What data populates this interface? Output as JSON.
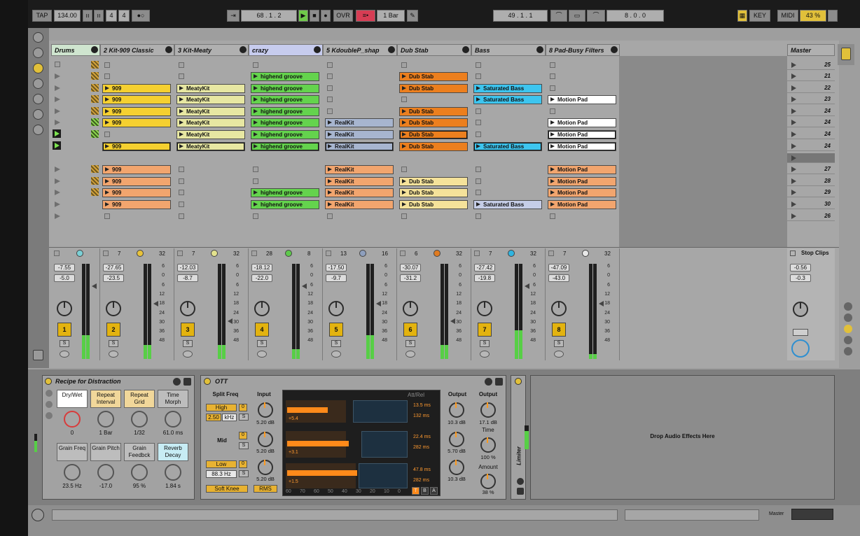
{
  "transport": {
    "tap": "TAP",
    "tempo": "134.00",
    "sig_num": "4",
    "sig_den": "4",
    "position": "68 . 1 . 2",
    "ovr": "OVR",
    "quantize": "1 Bar",
    "loop_start": "49 . 1 . 1",
    "loop_len": "8 . 0 . 0",
    "key": "KEY",
    "midi": "MIDI",
    "cpu": "43 %"
  },
  "tracks": [
    {
      "name": "Drums",
      "num": "1",
      "vol": "-7.55",
      "peak": "-5.0",
      "s1": "",
      "s2": "",
      "color": "#7bd0d6"
    },
    {
      "name": "2 Kit-909 Classic",
      "num": "2",
      "vol": "-27.65",
      "peak": "-23.5",
      "s1": "7",
      "s2": "32",
      "color": "#e8c23a"
    },
    {
      "name": "3 Kit-Meaty",
      "num": "3",
      "vol": "-12.03",
      "peak": "-8.7",
      "s1": "7",
      "s2": "32",
      "color": "#e3e28e"
    },
    {
      "name": "crazy",
      "num": "4",
      "vol": "-18.12",
      "peak": "-22.0",
      "s1": "28",
      "s2": "8",
      "color": "#5ec94b"
    },
    {
      "name": "5 KdoubleP_shap",
      "num": "5",
      "vol": "-17.50",
      "peak": "-9.7",
      "s1": "13",
      "s2": "16",
      "color": "#8e9fbd"
    },
    {
      "name": "Dub Stab",
      "num": "6",
      "vol": "-30.07",
      "peak": "-31.2",
      "s1": "6",
      "s2": "32",
      "color": "#e07b20"
    },
    {
      "name": "Bass",
      "num": "7",
      "vol": "-27.42",
      "peak": "-19.8",
      "s1": "7",
      "s2": "32",
      "color": "#2fb4e0"
    },
    {
      "name": "8 Pad-Busy Filters",
      "num": "8",
      "vol": "-47.09",
      "peak": "-43.0",
      "s1": "7",
      "s2": "32",
      "color": "#e8e8e8"
    }
  ],
  "master": {
    "name": "Master",
    "vol": "-0.56",
    "peak": "-0.3",
    "stop_clips": "Stop Clips"
  },
  "scenes": [
    "25",
    "21",
    "22",
    "23",
    "24",
    "24",
    "24",
    "24",
    "",
    "27",
    "28",
    "29",
    "30",
    "26"
  ],
  "clip_names": {
    "kit909": "909",
    "meaty": "MeatyKit",
    "groove": "highend groove",
    "realkit": "RealKit",
    "dubstab": "Dub Stab",
    "bass": "Saturated Bass",
    "pad": "Motion Pad"
  },
  "meter_scale": [
    "6",
    "0",
    "6",
    "12",
    "18",
    "24",
    "30",
    "36",
    "48"
  ],
  "meter_levels": [
    0.25,
    0.15,
    0.15,
    0.1,
    0.25,
    0.15,
    0.3,
    0.05,
    0.88
  ],
  "solo": "S",
  "rack": {
    "title": "Recipe for Distraction",
    "macros": [
      {
        "label": "Dry/Wet",
        "value": "0"
      },
      {
        "label": "Repeat Interval",
        "value": "1 Bar"
      },
      {
        "label": "Repeat Grid",
        "value": "1/32"
      },
      {
        "label": "Time Morph",
        "value": "61.0 ms"
      },
      {
        "label": "Grain Freq",
        "value": "23.5 Hz"
      },
      {
        "label": "Grain Pitch",
        "value": "-17.0"
      },
      {
        "label": "Grain Feedbck",
        "value": "95 %"
      },
      {
        "label": "Reverb Decay",
        "value": "1.84 s"
      }
    ]
  },
  "ott": {
    "title": "OTT",
    "split_freq": "Split Freq",
    "input": "Input",
    "att_rel": "Att/Rel",
    "output": "Output",
    "output2": "Output",
    "high": "High",
    "high_freq": "2.50",
    "high_unit": "kHz",
    "mid": "Mid",
    "low": "Low",
    "low_freq": "88.3 Hz",
    "soft_knee": "Soft Knee",
    "rms": "RMS",
    "input_vals": [
      "5.20 dB",
      "5.20 dB",
      "5.20 dB"
    ],
    "band_vals": [
      "+5.4",
      "+3.1",
      "+1.5"
    ],
    "att": [
      "13.5 ms",
      "22.4 ms",
      "47.8 ms"
    ],
    "rel": [
      "132 ms",
      "282 ms",
      "282 ms"
    ],
    "out_vals": [
      "10.3 dB",
      "5.70 dB",
      "10.3 dB"
    ],
    "out2_val": "17.1 dB",
    "time_label": "Time",
    "time_val": "100 %",
    "amount_label": "Amount",
    "amount_val": "38 %",
    "scale": [
      "60",
      "70",
      "60",
      "50",
      "40",
      "30",
      "20",
      "10",
      "0"
    ],
    "tbtns": [
      "T",
      "B",
      "A"
    ]
  },
  "limiter": "Limiter",
  "drop_text": "Drop Audio Effects Here",
  "master_label": "Master"
}
